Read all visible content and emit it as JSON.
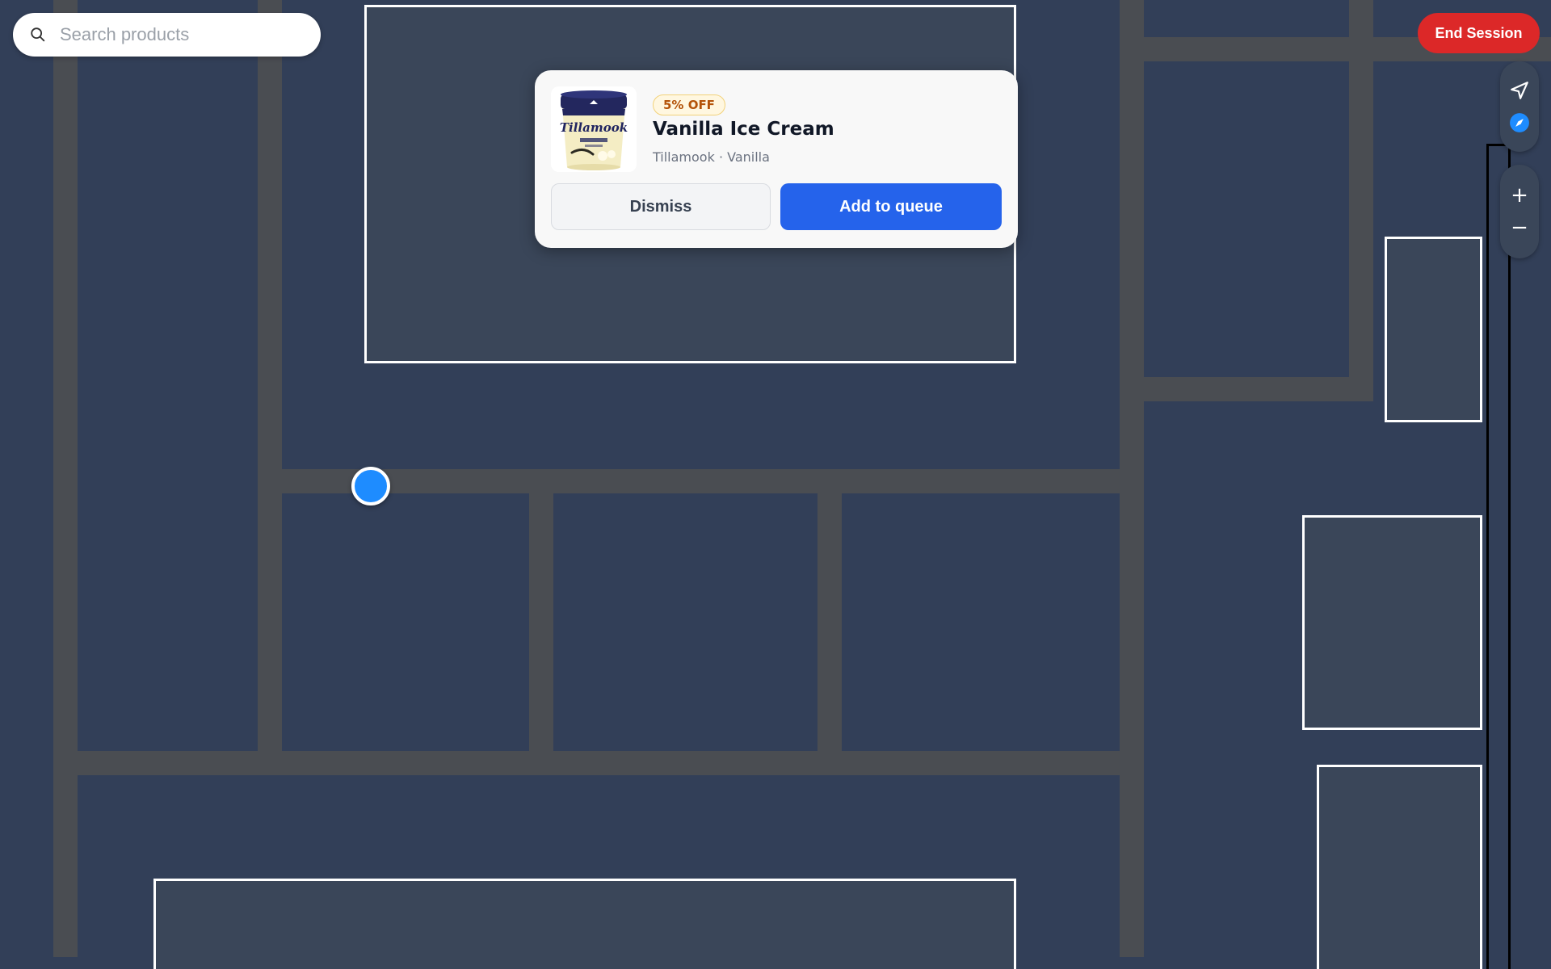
{
  "search": {
    "placeholder": "Search products",
    "icon": "search-icon"
  },
  "header": {
    "end_session_label": "End Session",
    "end_session_color": "#dc2828"
  },
  "map_controls": {
    "locate_icon": "navigation-arrow-icon",
    "compass_icon": "compass-icon",
    "zoom_in_label": "+",
    "zoom_out_label": "−"
  },
  "product_card": {
    "badge": "5% OFF",
    "name": "Vanilla Ice Cream",
    "subtitle": "Tillamook · Vanilla",
    "image_brand_text": "Tillamook",
    "dismiss_label": "Dismiss",
    "add_label": "Add to queue",
    "accent_color": "#2563eb"
  },
  "map": {
    "background_color": "#323f58",
    "aisle_color": "#4a4d52",
    "user_location_color": "#1e8cff"
  }
}
